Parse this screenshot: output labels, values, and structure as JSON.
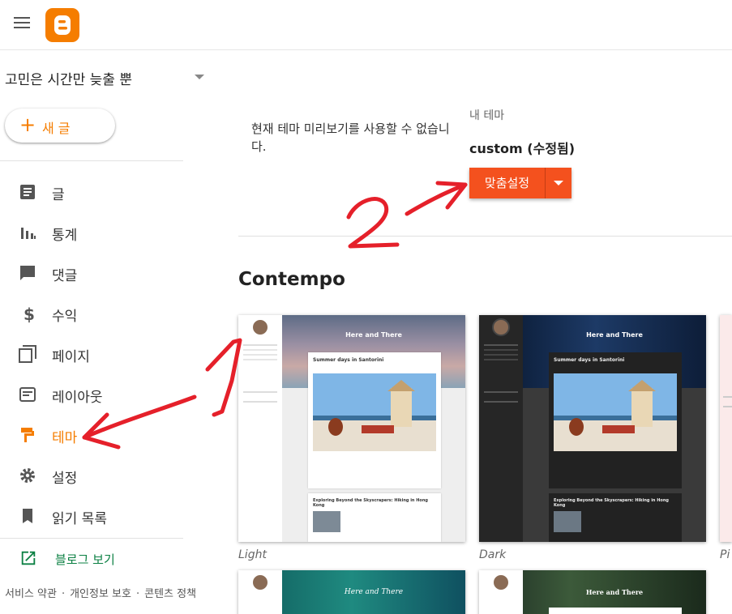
{
  "sidebar": {
    "blog_name": "고민은 시간만 늦출 뿐",
    "new_post_label": "새 글",
    "items": [
      {
        "label": "글",
        "icon": "posts-icon"
      },
      {
        "label": "통계",
        "icon": "stats-icon"
      },
      {
        "label": "댓글",
        "icon": "comments-icon"
      },
      {
        "label": "수익",
        "icon": "earnings-icon"
      },
      {
        "label": "페이지",
        "icon": "pages-icon"
      },
      {
        "label": "레이아웃",
        "icon": "layout-icon"
      },
      {
        "label": "테마",
        "icon": "theme-icon",
        "active": true
      },
      {
        "label": "설정",
        "icon": "settings-icon"
      },
      {
        "label": "읽기 목록",
        "icon": "reading-list-icon"
      }
    ],
    "view_blog_label": "블로그 보기",
    "footer": {
      "terms": "서비스 약관",
      "privacy": "개인정보 보호",
      "content_policy": "콘텐츠 정책"
    }
  },
  "main": {
    "preview_message": "현재 테마 미리보기를 사용할 수 없습니다.",
    "my_theme_label": "내 테마",
    "theme_name": "custom (수정됨)",
    "customize_label": "맞춤설정",
    "section_title": "Contempo",
    "themes": [
      {
        "name": "Light",
        "hero_title": "Here and There",
        "post_title": "Summer days in Santorini",
        "post2_title": "Exploring Beyond the Skyscrapers: Hiking in Hong Kong"
      },
      {
        "name": "Dark",
        "hero_title": "Here and There",
        "post_title": "Summer days in Santorini",
        "post2_title": "Exploring Beyond the Skyscrapers: Hiking in Hong Kong"
      },
      {
        "name": "Pi"
      }
    ],
    "row2": [
      {
        "hero_title": "Here and There"
      },
      {
        "hero_title": "Here and There"
      }
    ]
  },
  "annotations": {
    "step1": "1",
    "step2": "2"
  },
  "colors": {
    "accent": "#f57d00",
    "customize_button": "#f4511e",
    "annotation": "#e5202a",
    "view_blog": "#0b8043"
  }
}
